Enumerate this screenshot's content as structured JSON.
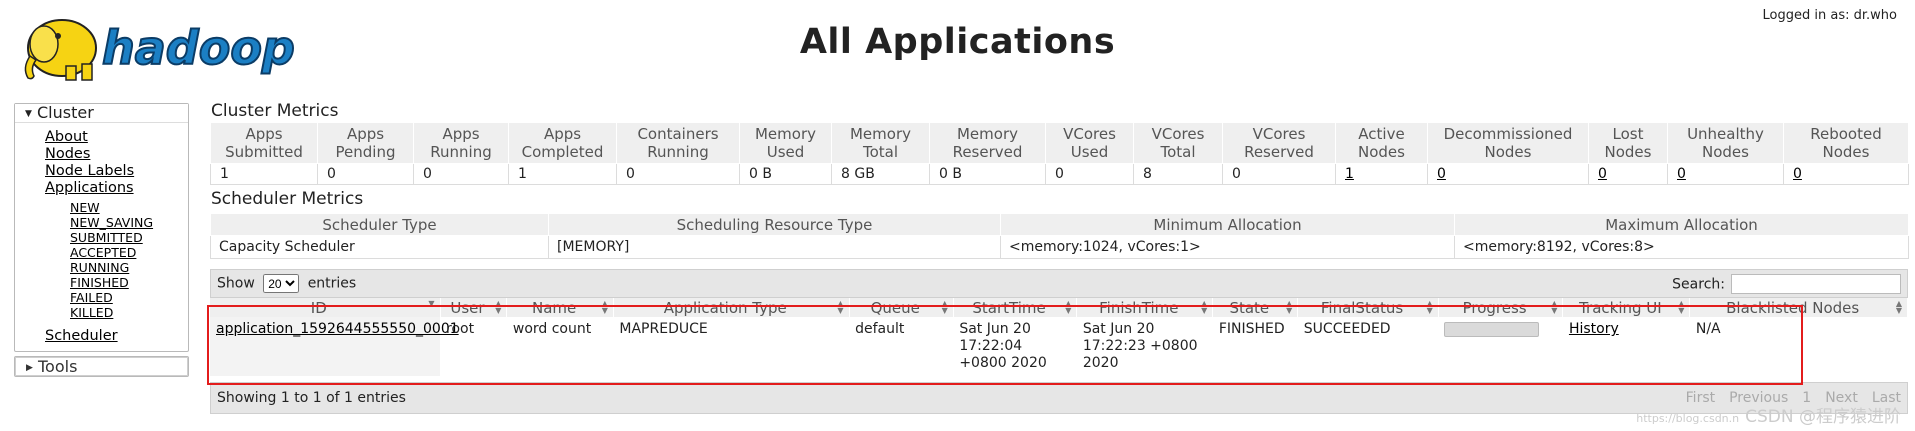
{
  "header": {
    "logo_text": "hadoop",
    "page_title": "All Applications",
    "logged_in": "Logged in as: dr.who"
  },
  "nav": {
    "cluster_label": "Cluster",
    "links": [
      "About",
      "Nodes",
      "Node Labels",
      "Applications"
    ],
    "states": [
      "NEW",
      "NEW_SAVING",
      "SUBMITTED",
      "ACCEPTED",
      "RUNNING",
      "FINISHED",
      "FAILED",
      "KILLED"
    ],
    "scheduler": "Scheduler",
    "tools_label": "Tools"
  },
  "cluster_metrics": {
    "title": "Cluster Metrics",
    "headers": [
      "Apps Submitted",
      "Apps Pending",
      "Apps Running",
      "Apps Completed",
      "Containers Running",
      "Memory Used",
      "Memory Total",
      "Memory Reserved",
      "VCores Used",
      "VCores Total",
      "VCores Reserved",
      "Active Nodes",
      "Decommissioned Nodes",
      "Lost Nodes",
      "Unhealthy Nodes",
      "Rebooted Nodes"
    ],
    "values": [
      "1",
      "0",
      "0",
      "1",
      "0",
      "0 B",
      "8 GB",
      "0 B",
      "0",
      "8",
      "0",
      "1",
      "0",
      "0",
      "0",
      "0"
    ]
  },
  "scheduler_metrics": {
    "title": "Scheduler Metrics",
    "headers": [
      "Scheduler Type",
      "Scheduling Resource Type",
      "Minimum Allocation",
      "Maximum Allocation"
    ],
    "values": [
      "Capacity Scheduler",
      "[MEMORY]",
      "<memory:1024, vCores:1>",
      "<memory:8192, vCores:8>"
    ]
  },
  "apps_table": {
    "show_label": "Show",
    "entries_value": "20",
    "entries_label": "entries",
    "search_label": "Search:",
    "headers": [
      "ID",
      "User",
      "Name",
      "Application Type",
      "Queue",
      "StartTime",
      "FinishTime",
      "State",
      "FinalStatus",
      "Progress",
      "Tracking UI",
      "Blacklisted Nodes"
    ],
    "row": {
      "id": "application_1592644555550_0001",
      "user": "root",
      "name": "word count",
      "type": "MAPREDUCE",
      "queue": "default",
      "start": "Sat Jun 20 17:22:04 +0800 2020",
      "finish": "Sat Jun 20 17:22:23 +0800 2020",
      "state": "FINISHED",
      "final_status": "SUCCEEDED",
      "progress": 1.0,
      "tracking": "History",
      "blacklisted": "N/A"
    },
    "footer_info": "Showing 1 to 1 of 1 entries",
    "pager": [
      "First",
      "Previous",
      "1",
      "Next",
      "Last"
    ]
  },
  "watermark": {
    "url": "https://blog.csdn.n",
    "text": "CSDN @程序猿进阶"
  },
  "colors": {
    "highlight_border": "#e31c1c",
    "logo_yellow": "#f6d313",
    "logo_blue": "#1b7fc4"
  }
}
